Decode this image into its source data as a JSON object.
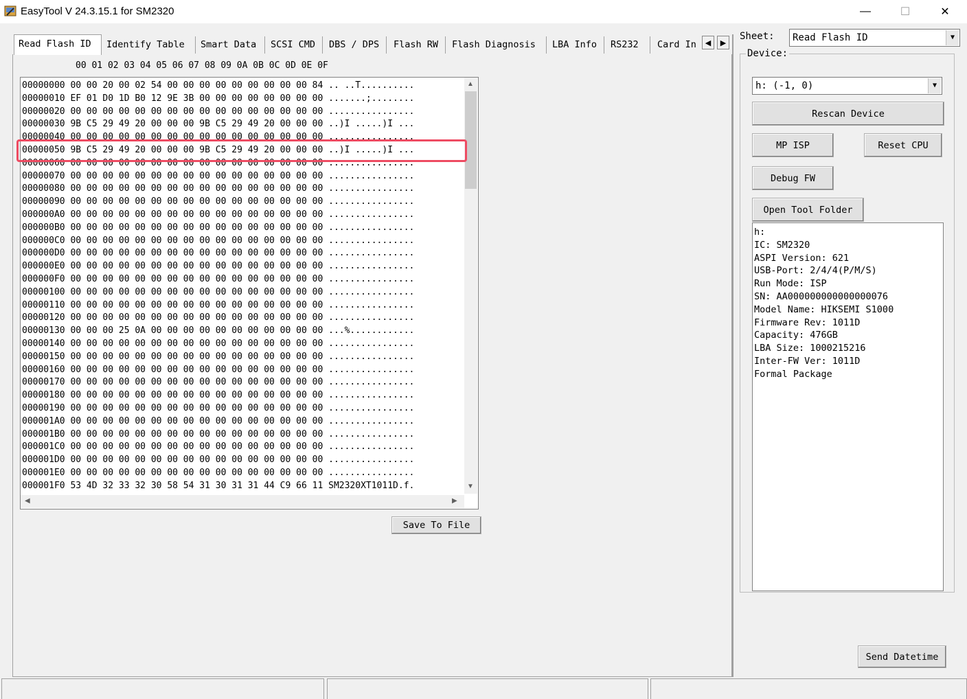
{
  "window": {
    "title": "EasyTool  V 24.3.15.1   for SM2320",
    "minimize": "—",
    "maximize": "☐",
    "close": "✕"
  },
  "tabs": [
    {
      "label": "Read Flash ID",
      "active": true
    },
    {
      "label": "Identify Table"
    },
    {
      "label": "Smart Data"
    },
    {
      "label": "SCSI CMD"
    },
    {
      "label": "DBS / DPS"
    },
    {
      "label": "Flash RW"
    },
    {
      "label": "Flash Diagnosis"
    },
    {
      "label": "LBA Info"
    },
    {
      "label": "RS232"
    },
    {
      "label": "Card In"
    }
  ],
  "tab_scroll": {
    "left": "◀",
    "right": "▶"
  },
  "hex": {
    "header": "00 01 02 03 04 05 06 07 08 09 0A 0B 0C 0D 0E 0F",
    "rows": [
      "00000000 00 00 20 00 02 54 00 00 00 00 00 00 00 00 00 84 .. ..T..........",
      "00000010 EF 01 D0 1D B0 12 9E 3B 00 00 00 00 00 00 00 00 .......;........",
      "00000020 00 00 00 00 00 00 00 00 00 00 00 00 00 00 00 00 ................",
      "00000030 9B C5 29 49 20 00 00 00 9B C5 29 49 20 00 00 00 ..)I .....)I ...",
      "00000040 00 00 00 00 00 00 00 00 00 00 00 00 00 00 00 00 ................",
      "00000050 9B C5 29 49 20 00 00 00 9B C5 29 49 20 00 00 00 ..)I .....)I ...",
      "00000060 00 00 00 00 00 00 00 00 00 00 00 00 00 00 00 00 ................",
      "00000070 00 00 00 00 00 00 00 00 00 00 00 00 00 00 00 00 ................",
      "00000080 00 00 00 00 00 00 00 00 00 00 00 00 00 00 00 00 ................",
      "00000090 00 00 00 00 00 00 00 00 00 00 00 00 00 00 00 00 ................",
      "000000A0 00 00 00 00 00 00 00 00 00 00 00 00 00 00 00 00 ................",
      "000000B0 00 00 00 00 00 00 00 00 00 00 00 00 00 00 00 00 ................",
      "000000C0 00 00 00 00 00 00 00 00 00 00 00 00 00 00 00 00 ................",
      "000000D0 00 00 00 00 00 00 00 00 00 00 00 00 00 00 00 00 ................",
      "000000E0 00 00 00 00 00 00 00 00 00 00 00 00 00 00 00 00 ................",
      "000000F0 00 00 00 00 00 00 00 00 00 00 00 00 00 00 00 00 ................",
      "00000100 00 00 00 00 00 00 00 00 00 00 00 00 00 00 00 00 ................",
      "00000110 00 00 00 00 00 00 00 00 00 00 00 00 00 00 00 00 ................",
      "00000120 00 00 00 00 00 00 00 00 00 00 00 00 00 00 00 00 ................",
      "00000130 00 00 00 25 0A 00 00 00 00 00 00 00 00 00 00 00 ...%............",
      "00000140 00 00 00 00 00 00 00 00 00 00 00 00 00 00 00 00 ................",
      "00000150 00 00 00 00 00 00 00 00 00 00 00 00 00 00 00 00 ................",
      "00000160 00 00 00 00 00 00 00 00 00 00 00 00 00 00 00 00 ................",
      "00000170 00 00 00 00 00 00 00 00 00 00 00 00 00 00 00 00 ................",
      "00000180 00 00 00 00 00 00 00 00 00 00 00 00 00 00 00 00 ................",
      "00000190 00 00 00 00 00 00 00 00 00 00 00 00 00 00 00 00 ................",
      "000001A0 00 00 00 00 00 00 00 00 00 00 00 00 00 00 00 00 ................",
      "000001B0 00 00 00 00 00 00 00 00 00 00 00 00 00 00 00 00 ................",
      "000001C0 00 00 00 00 00 00 00 00 00 00 00 00 00 00 00 00 ................",
      "000001D0 00 00 00 00 00 00 00 00 00 00 00 00 00 00 00 00 ................",
      "000001E0 00 00 00 00 00 00 00 00 00 00 00 00 00 00 00 00 ................",
      "000001F0 53 4D 32 33 32 30 58 54 31 30 31 31 44 C9 66 11 SM2320XT1011D.f."
    ],
    "highlight_color": "#ee4b62"
  },
  "buttons": {
    "save_to_file": "Save To File",
    "rescan_device": "Rescan Device",
    "mp_isp": "MP ISP",
    "reset_cpu": "Reset CPU",
    "debug_fw": "Debug FW",
    "open_tool_folder": "Open Tool Folder",
    "send_datetime": "Send Datetime"
  },
  "sheet": {
    "label": "Sheet:",
    "value": "Read Flash ID"
  },
  "device": {
    "label": "Device:",
    "value": "h:  (-1,  0)",
    "info": [
      "h:",
      "IC: SM2320",
      "ASPI Version: 621",
      "USB-Port: 2/4/4(P/M/S)",
      "Run Mode: ISP",
      "SN: AA000000000000000076",
      "Model Name: HIKSEMI S1000",
      "Firmware Rev: 1011D",
      "Capacity: 476GB",
      "LBA Size: 1000215216",
      "Inter-FW Ver: 1011D",
      "Formal Package"
    ]
  }
}
